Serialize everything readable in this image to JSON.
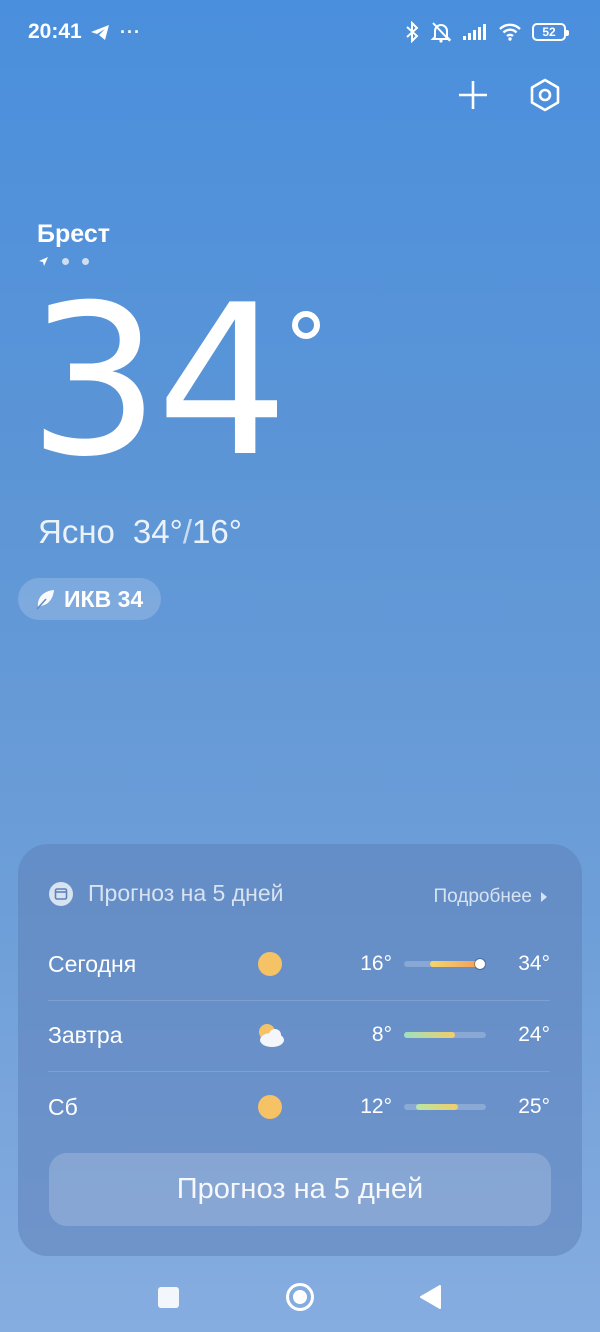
{
  "status_bar": {
    "time": "20:41",
    "overflow": "···",
    "battery": "52",
    "icons": [
      "telegram-icon",
      "bluetooth-icon",
      "bell-off-icon",
      "signal-icon",
      "wifi-icon"
    ]
  },
  "header": {
    "icons": [
      "plus-icon",
      "settings-hexagon-icon"
    ]
  },
  "location": {
    "city": "Брест",
    "pages": 3
  },
  "current": {
    "temperature": "34",
    "condition": "Ясно",
    "high": "34°",
    "low": "16°",
    "separator": "/"
  },
  "aqi": {
    "label": "ИКВ 34"
  },
  "forecast": {
    "title": "Прогноз на 5 дней",
    "more_label": "Подробнее",
    "days": [
      {
        "name": "Сегодня",
        "icon": "sun-icon",
        "low": "16°",
        "high": "34°",
        "bar": {
          "start": 0.32,
          "end": 0.98,
          "now": 0.93,
          "gradient": [
            "#f5d56a",
            "#f29a5c"
          ]
        }
      },
      {
        "name": "Завтра",
        "icon": "partly-cloudy-icon",
        "low": "8°",
        "high": "24°",
        "bar": {
          "start": 0.0,
          "end": 0.62,
          "gradient": [
            "#9fe0c0",
            "#f0cd6a"
          ]
        }
      },
      {
        "name": "Сб",
        "icon": "sun-icon",
        "low": "12°",
        "high": "25°",
        "bar": {
          "start": 0.15,
          "end": 0.66,
          "gradient": [
            "#b9e6a6",
            "#f0cd6a"
          ]
        }
      }
    ],
    "button_label": "Прогноз на 5 дней"
  },
  "colors": {
    "sun": "#f6c266",
    "bg_top": "#4a8fdd",
    "bg_bottom": "#86ade0"
  }
}
